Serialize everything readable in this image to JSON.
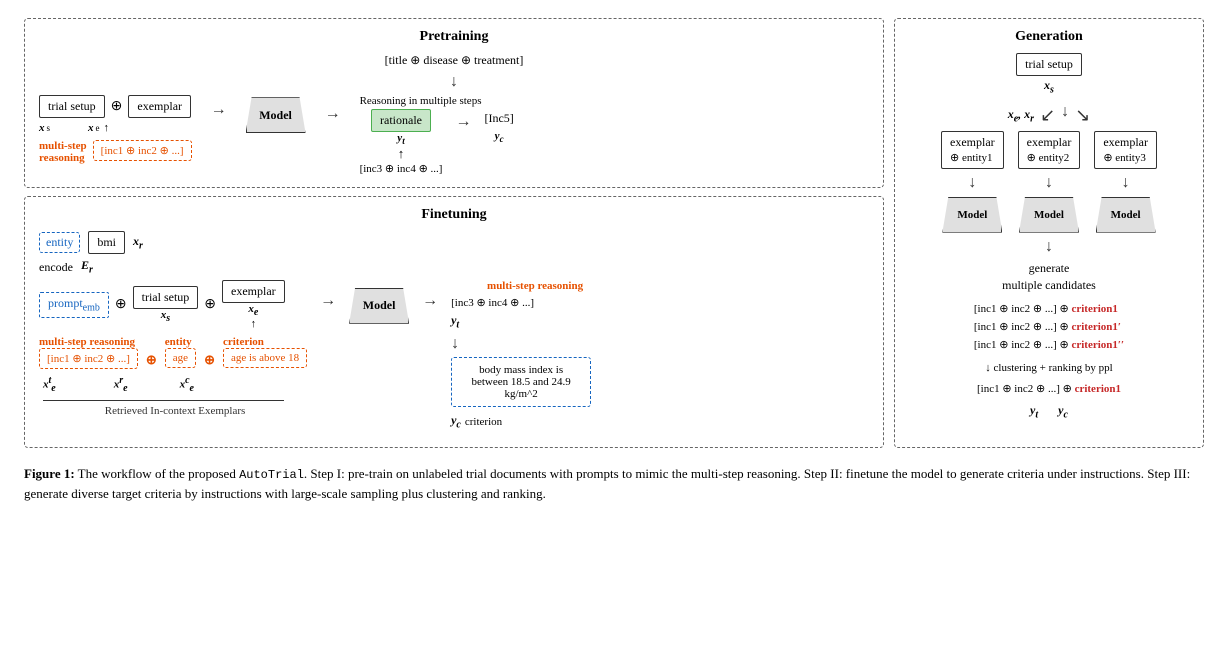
{
  "pretraining": {
    "title": "Pretraining",
    "input": "[title ⊕ disease ⊕ treatment]",
    "nodes": {
      "trial_setup": "trial setup",
      "exemplar": "exemplar",
      "model": "Model",
      "rationale": "rationale"
    },
    "labels": {
      "xs": "x",
      "xe": "x",
      "yt": "y",
      "yc": "y",
      "xs_sub": "s",
      "xe_sub": "e",
      "yt_sub": "t",
      "yc_sub": "c"
    },
    "multi_step_label": "multi-step",
    "reasoning_label": "reasoning",
    "reasoning_steps": "Reasoning in multiple steps",
    "inc5": "[Inc5]",
    "inc3_inc4": "[inc3 ⊕ inc4 ⊕ ...]",
    "inc1_inc2": "[inc1 ⊕ inc2 ⊕ ...]"
  },
  "finetuning": {
    "title": "Finetuning",
    "entity_label": "entity",
    "bmi_label": "bmi",
    "xr_label": "x",
    "xr_sub": "r",
    "encode_label": "encode",
    "Er_label": "E",
    "Er_sub": "r",
    "nodes": {
      "prompt_emb": "prompt",
      "prompt_sub": "emb",
      "trial_setup": "trial setup",
      "exemplar": "exemplar",
      "model": "Model"
    },
    "labels": {
      "xs": "x",
      "xe": "x",
      "xs_sub": "s",
      "xe_sub": "e",
      "yt": "y",
      "yt_sub": "t"
    },
    "multi_step_reasoning": "multi-step reasoning",
    "entity_label2": "entity",
    "criterion_label": "criterion",
    "inc3_inc4": "[inc3 ⊕ inc4 ⊕ ...]",
    "inc1_inc2": "[inc1 ⊕ inc2 ⊕ ...]",
    "age": "age",
    "age_condition": "age is above 18",
    "criterion_text": "body mass index is between 18.5 and 24.9 kg/m^2",
    "yc_label": "y",
    "yc_sub": "c",
    "criterion_word": "criterion",
    "retrieved_label": "Retrieved In-context Exemplars",
    "xe_t_sub": "t",
    "xe_r_sub": "r",
    "xe_c_sub": "c",
    "xe_t_label": "x",
    "xe_r_label": "x",
    "xe_c_label": "x"
  },
  "generation": {
    "title": "Generation",
    "trial_setup": "trial setup",
    "xs_label": "x",
    "xs_sub": "s",
    "xe_xr_label": "x",
    "xe_sub": "e",
    "xr_sub": "r",
    "exemplars": [
      {
        "label": "exemplar",
        "entity": "⊕ entity1"
      },
      {
        "label": "exemplar",
        "entity": "⊕ entity2"
      },
      {
        "label": "exemplar",
        "entity": "⊕ entity3"
      }
    ],
    "models": [
      "Model",
      "Model",
      "Model"
    ],
    "generate_label": "generate",
    "multiple_candidates": "multiple candidates",
    "candidates": [
      "[inc1 ⊕ inc2 ⊕ ...] ⊕ criterion1",
      "[inc1 ⊕ inc2 ⊕ ...] ⊕ criterion1′",
      "[inc1 ⊕ inc2 ⊕ ...] ⊕ criterion1′′"
    ],
    "clustering_label": "↓ clustering + ranking by ppl",
    "final_inc": "[inc1 ⊕ inc2 ⊕ ...] ⊕",
    "final_criterion": "criterion1",
    "yt_label": "y",
    "yt_sub": "t",
    "yc_label": "y",
    "yc_sub": "c"
  },
  "caption": {
    "figure_label": "Figure 1:",
    "text": "The workflow of the proposed AutoTrial. Step I: pre-train on unlabeled trial documents with prompts to mimic the multi-step reasoning. Step II: finetune the model to generate criteria under instructions. Step III: generate diverse target criteria by instructions with large-scale sampling plus clustering and ranking."
  }
}
